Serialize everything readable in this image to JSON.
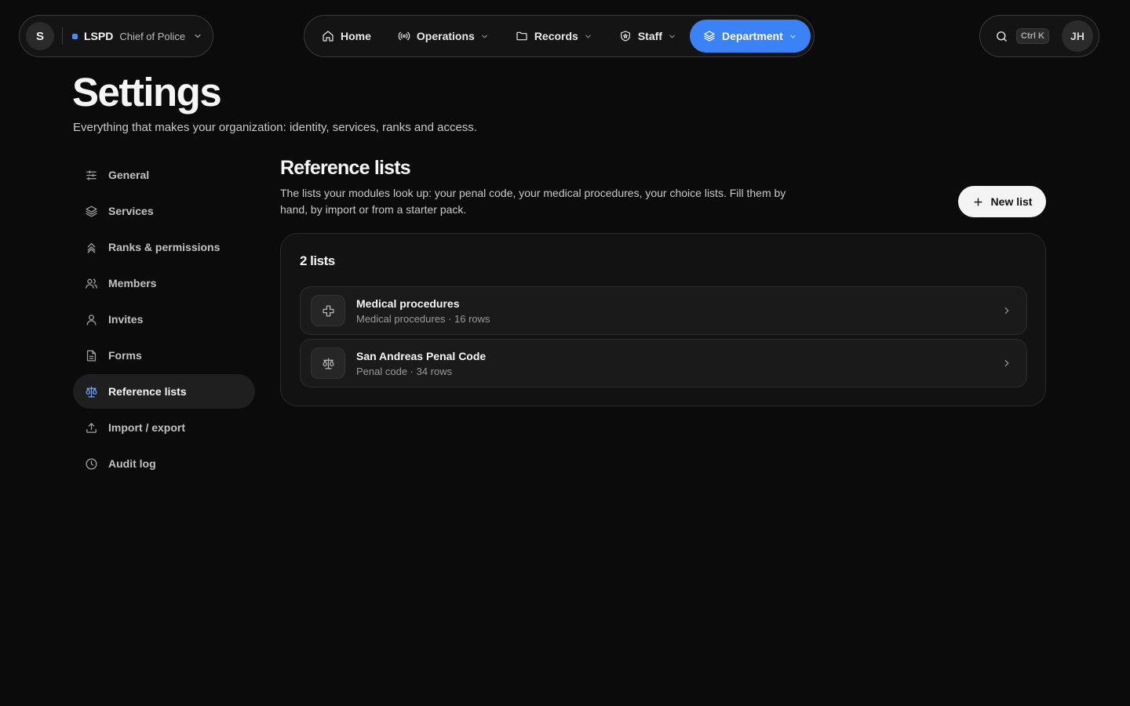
{
  "org": {
    "avatar": "S",
    "name": "LSPD",
    "role": "Chief of Police"
  },
  "nav": [
    {
      "label": "Home",
      "icon": "home-icon"
    },
    {
      "label": "Operations",
      "icon": "broadcast-icon"
    },
    {
      "label": "Records",
      "icon": "folder-icon"
    },
    {
      "label": "Staff",
      "icon": "shield-icon"
    },
    {
      "label": "Department",
      "icon": "layers-icon"
    }
  ],
  "search": {
    "shortcut": "Ctrl K"
  },
  "user": {
    "initials": "JH"
  },
  "page": {
    "title": "Settings",
    "subtitle": "Everything that makes your organization: identity, services, ranks and access."
  },
  "sidebar": [
    {
      "label": "General",
      "icon": "sliders-icon"
    },
    {
      "label": "Services",
      "icon": "layers-icon"
    },
    {
      "label": "Ranks & permissions",
      "icon": "chevrons-up-icon"
    },
    {
      "label": "Members",
      "icon": "users-icon"
    },
    {
      "label": "Invites",
      "icon": "user-icon"
    },
    {
      "label": "Forms",
      "icon": "document-icon"
    },
    {
      "label": "Reference lists",
      "icon": "scale-icon"
    },
    {
      "label": "Import / export",
      "icon": "upload-icon"
    },
    {
      "label": "Audit log",
      "icon": "clock-icon"
    }
  ],
  "section": {
    "title": "Reference lists",
    "description": "The lists your modules look up: your penal code, your medical procedures, your choice lists. Fill them by hand, by import or from a starter pack.",
    "new_button": "New list",
    "count": "2 lists"
  },
  "lists": [
    {
      "name": "Medical procedures",
      "meta": "Medical procedures · 16 rows",
      "icon": "medical-cross-icon"
    },
    {
      "name": "San Andreas Penal Code",
      "meta": "Penal code · 34 rows",
      "icon": "scale-icon"
    }
  ],
  "colors": {
    "accent": "#3b82f6",
    "background": "#0b0b0b"
  }
}
